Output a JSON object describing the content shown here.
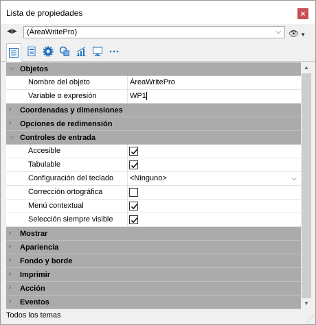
{
  "window": {
    "title": "Lista de propiedades",
    "close_icon": "close-icon"
  },
  "selector": {
    "value": "(ÁreaWritePro)",
    "nav": "◀▶"
  },
  "tabs": [
    {
      "name": "tab-list",
      "icon": "list-icon"
    },
    {
      "name": "tab-document",
      "icon": "document-icon"
    },
    {
      "name": "tab-settings",
      "icon": "gear-icon"
    },
    {
      "name": "tab-shapes",
      "icon": "shapes-icon"
    },
    {
      "name": "tab-chart",
      "icon": "chart-icon"
    },
    {
      "name": "tab-monitor",
      "icon": "monitor-icon"
    },
    {
      "name": "tab-more",
      "icon": "more-icon"
    }
  ],
  "sections": {
    "objetos": "Objetos",
    "coordenadas": "Coordenadas y dimensiones",
    "redimension": "Opciones de redimensión",
    "controles": "Controles de entrada",
    "mostrar": "Mostrar",
    "apariencia": "Apariencia",
    "fondo": "Fondo y borde",
    "imprimir": "Imprimir",
    "accion": "Acción",
    "eventos": "Eventos"
  },
  "objetos": {
    "nombre_label": "Nombre del objeto",
    "nombre_value": "ÁreaWritePro",
    "variable_label": "Variable o expresión",
    "variable_value": "WP1"
  },
  "controles": {
    "accesible_label": "Accesible",
    "accesible": true,
    "tabulable_label": "Tabulable",
    "tabulable": true,
    "teclado_label": "Configuración del teclado",
    "teclado_value": "<Ninguno>",
    "correccion_label": "Corrección ortográfica",
    "correccion": false,
    "menu_label": "Menú contextual",
    "menu": true,
    "seleccion_label": "Selección siempre visible",
    "seleccion": true
  },
  "status": {
    "text": "Todos los temas"
  },
  "colors": {
    "section_bg": "#ababab",
    "close_bg": "#c84e52"
  }
}
